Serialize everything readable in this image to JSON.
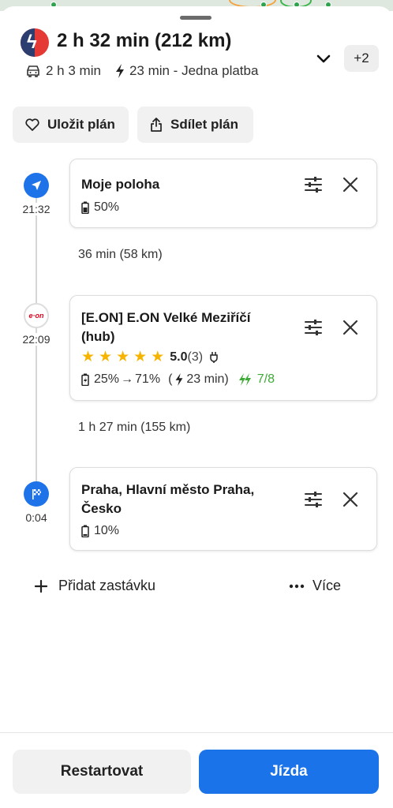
{
  "colors": {
    "accent_blue": "#1a73e8",
    "green": "#3daa36",
    "star": "#f6b400",
    "brand_red": "#e2001a"
  },
  "summary": {
    "title": "2 h 32 min (212 km)",
    "drive_time": "2 h 3 min",
    "charge_time": "23 min - Jedna platba",
    "more_count": "+2",
    "icons": {
      "logo": "app-logo-icon",
      "car": "car-icon",
      "bolt": "bolt-icon",
      "expand": "chevron-down-icon"
    }
  },
  "actions": {
    "save_label": "Uložit plán",
    "share_label": "Sdílet plán"
  },
  "stops": [
    {
      "time": "21:32",
      "title": "Moje poloha",
      "battery": "50%"
    },
    {
      "time": "22:09",
      "node_logo": "e·on",
      "title": "[E.ON] E.ON Velké Meziříčí (hub)",
      "rating": "5.0",
      "rating_count": "(3)",
      "battery_from": "25%",
      "battery_to": "71%",
      "charge_open": "(",
      "charge_duration": "23 min)",
      "availability": "7/8"
    },
    {
      "time": "0:04",
      "title": "Praha, Hlavní město Praha, Česko",
      "battery": "10%"
    }
  ],
  "legs": [
    "36 min (58 km)",
    "1 h 27 min (155 km)"
  ],
  "footer": {
    "add_stop": "Přidat zastávku",
    "more": "Více",
    "restart": "Restartovat",
    "drive": "Jízda"
  }
}
